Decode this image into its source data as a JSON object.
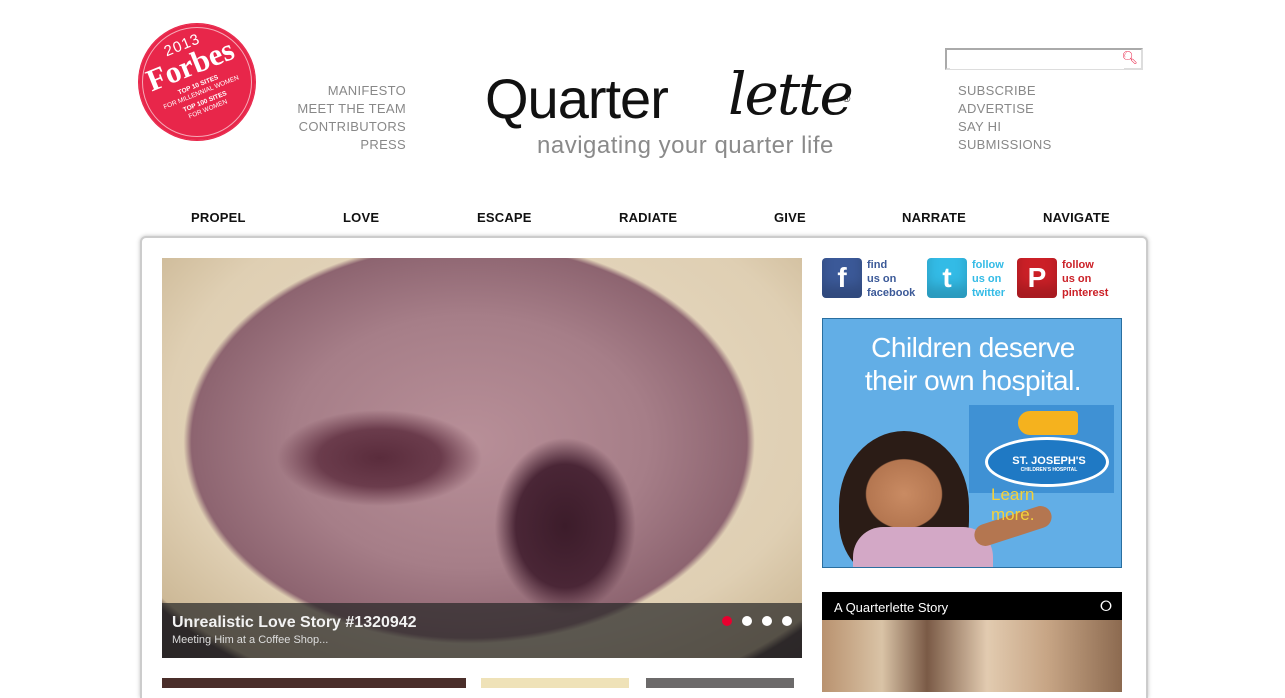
{
  "forbes": {
    "year": "2013",
    "brand": "Forbes",
    "line1": "TOP 10 SITES",
    "line2": "FOR MILLENNIAL WOMEN",
    "line3": "TOP 100 SITES",
    "line4": "FOR WOMEN"
  },
  "left_menu": [
    "MANIFESTO",
    "MEET THE TEAM",
    "CONTRIBUTORS",
    "PRESS"
  ],
  "right_menu": [
    "SUBSCRIBE",
    "ADVERTISE",
    "SAY HI",
    "SUBMISSIONS"
  ],
  "logo": {
    "part1": "Quarter",
    "part2": "lette",
    "registered": "®",
    "tagline": "navigating your quarter life"
  },
  "search": {
    "value": "",
    "placeholder": ""
  },
  "main_nav": [
    "PROPEL",
    "LOVE",
    "ESCAPE",
    "RADIATE",
    "GIVE",
    "NARRATE",
    "NAVIGATE"
  ],
  "slider": {
    "title": "Unrealistic Love Story #1320942",
    "subtitle": "Meeting Him at a Coffee Shop...",
    "active_index": 0,
    "slide_count": 4
  },
  "social": {
    "facebook": {
      "l1": "find",
      "l2": "us on",
      "l3": "facebook",
      "color": "#3b5998"
    },
    "twitter": {
      "l1": "follow",
      "l2": "us on",
      "l3": "twitter",
      "color": "#33bbe6"
    },
    "pinterest": {
      "l1": "follow",
      "l2": "us on",
      "l3": "pinterest",
      "color": "#cb2027"
    }
  },
  "ad": {
    "headline1": "Children deserve",
    "headline2": "their own hospital.",
    "hospital": "ST. JOSEPH'S",
    "hospital_sub": "CHILDREN'S HOSPITAL",
    "cta1": "Learn",
    "cta2": "more."
  },
  "story": {
    "title": "A Quarterlette Story"
  },
  "colors": {
    "accent": "#e8264a",
    "nav_text": "#111111",
    "menu_text": "#888888"
  }
}
